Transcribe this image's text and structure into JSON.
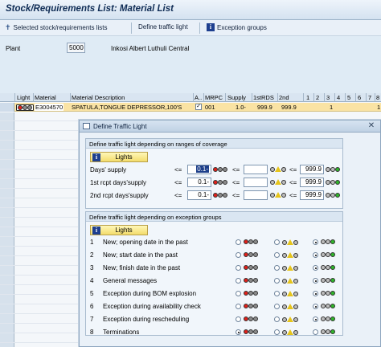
{
  "window": {
    "title": "Stock/Requirements List: Material List"
  },
  "toolbar": {
    "selected": "Selected stock/requirements lists",
    "define": "Define traffic light",
    "exception": "Exception groups"
  },
  "plant": {
    "label": "Plant",
    "value": "5000",
    "name": "Inkosi Albert Luthuli Central"
  },
  "grid": {
    "headers": [
      "Light",
      "Material",
      "Material Description",
      "A..",
      "MRPC",
      "Supply",
      "1stRDS",
      "2nd",
      "1",
      "2",
      "3",
      "4",
      "5",
      "6",
      "7",
      "8"
    ],
    "row": {
      "material": "E3004570",
      "description": "SPATULA,TONGUE DEPRESSOR,100'S",
      "mrpc": "001",
      "supply": "1.0-",
      "first": "999.9",
      "second": "999.9",
      "c4": "1",
      "c8": "1"
    }
  },
  "dialog": {
    "title": "Define Traffic Light",
    "coverage": {
      "title": "Define traffic light depending on ranges of coverage",
      "lights": "Lights",
      "rows": [
        {
          "label": "Days' supply",
          "op1": "<=",
          "v1": "0.1-",
          "op2": "<=",
          "op3": "<=",
          "v3": "999.9"
        },
        {
          "label": "1st rcpt days'supply",
          "op1": "<=",
          "v1": "0.1-",
          "op2": "<=",
          "op3": "<=",
          "v3": "999.9"
        },
        {
          "label": "2nd rcpt days'supply",
          "op1": "<=",
          "v1": "0.1-",
          "op2": "<=",
          "op3": "<=",
          "v3": "999.9"
        }
      ]
    },
    "exception": {
      "title": "Define traffic light depending on exception groups",
      "lights": "Lights",
      "rows": [
        {
          "num": "1",
          "label": "New; opening date in the past",
          "sel": 2
        },
        {
          "num": "2",
          "label": "New; start date in the past",
          "sel": 2
        },
        {
          "num": "3",
          "label": "New; finish date in the past",
          "sel": 2
        },
        {
          "num": "4",
          "label": "General messages",
          "sel": 2
        },
        {
          "num": "5",
          "label": "Exception during BOM explosion",
          "sel": 2
        },
        {
          "num": "6",
          "label": "Exception during availability check",
          "sel": 2
        },
        {
          "num": "7",
          "label": "Exception during rescheduling",
          "sel": 2
        },
        {
          "num": "8",
          "label": "Terminations",
          "sel": 0
        }
      ]
    }
  },
  "colors": {
    "red": "#e0201a",
    "yellow": "#f2cc1c",
    "green": "#2fb52b"
  }
}
